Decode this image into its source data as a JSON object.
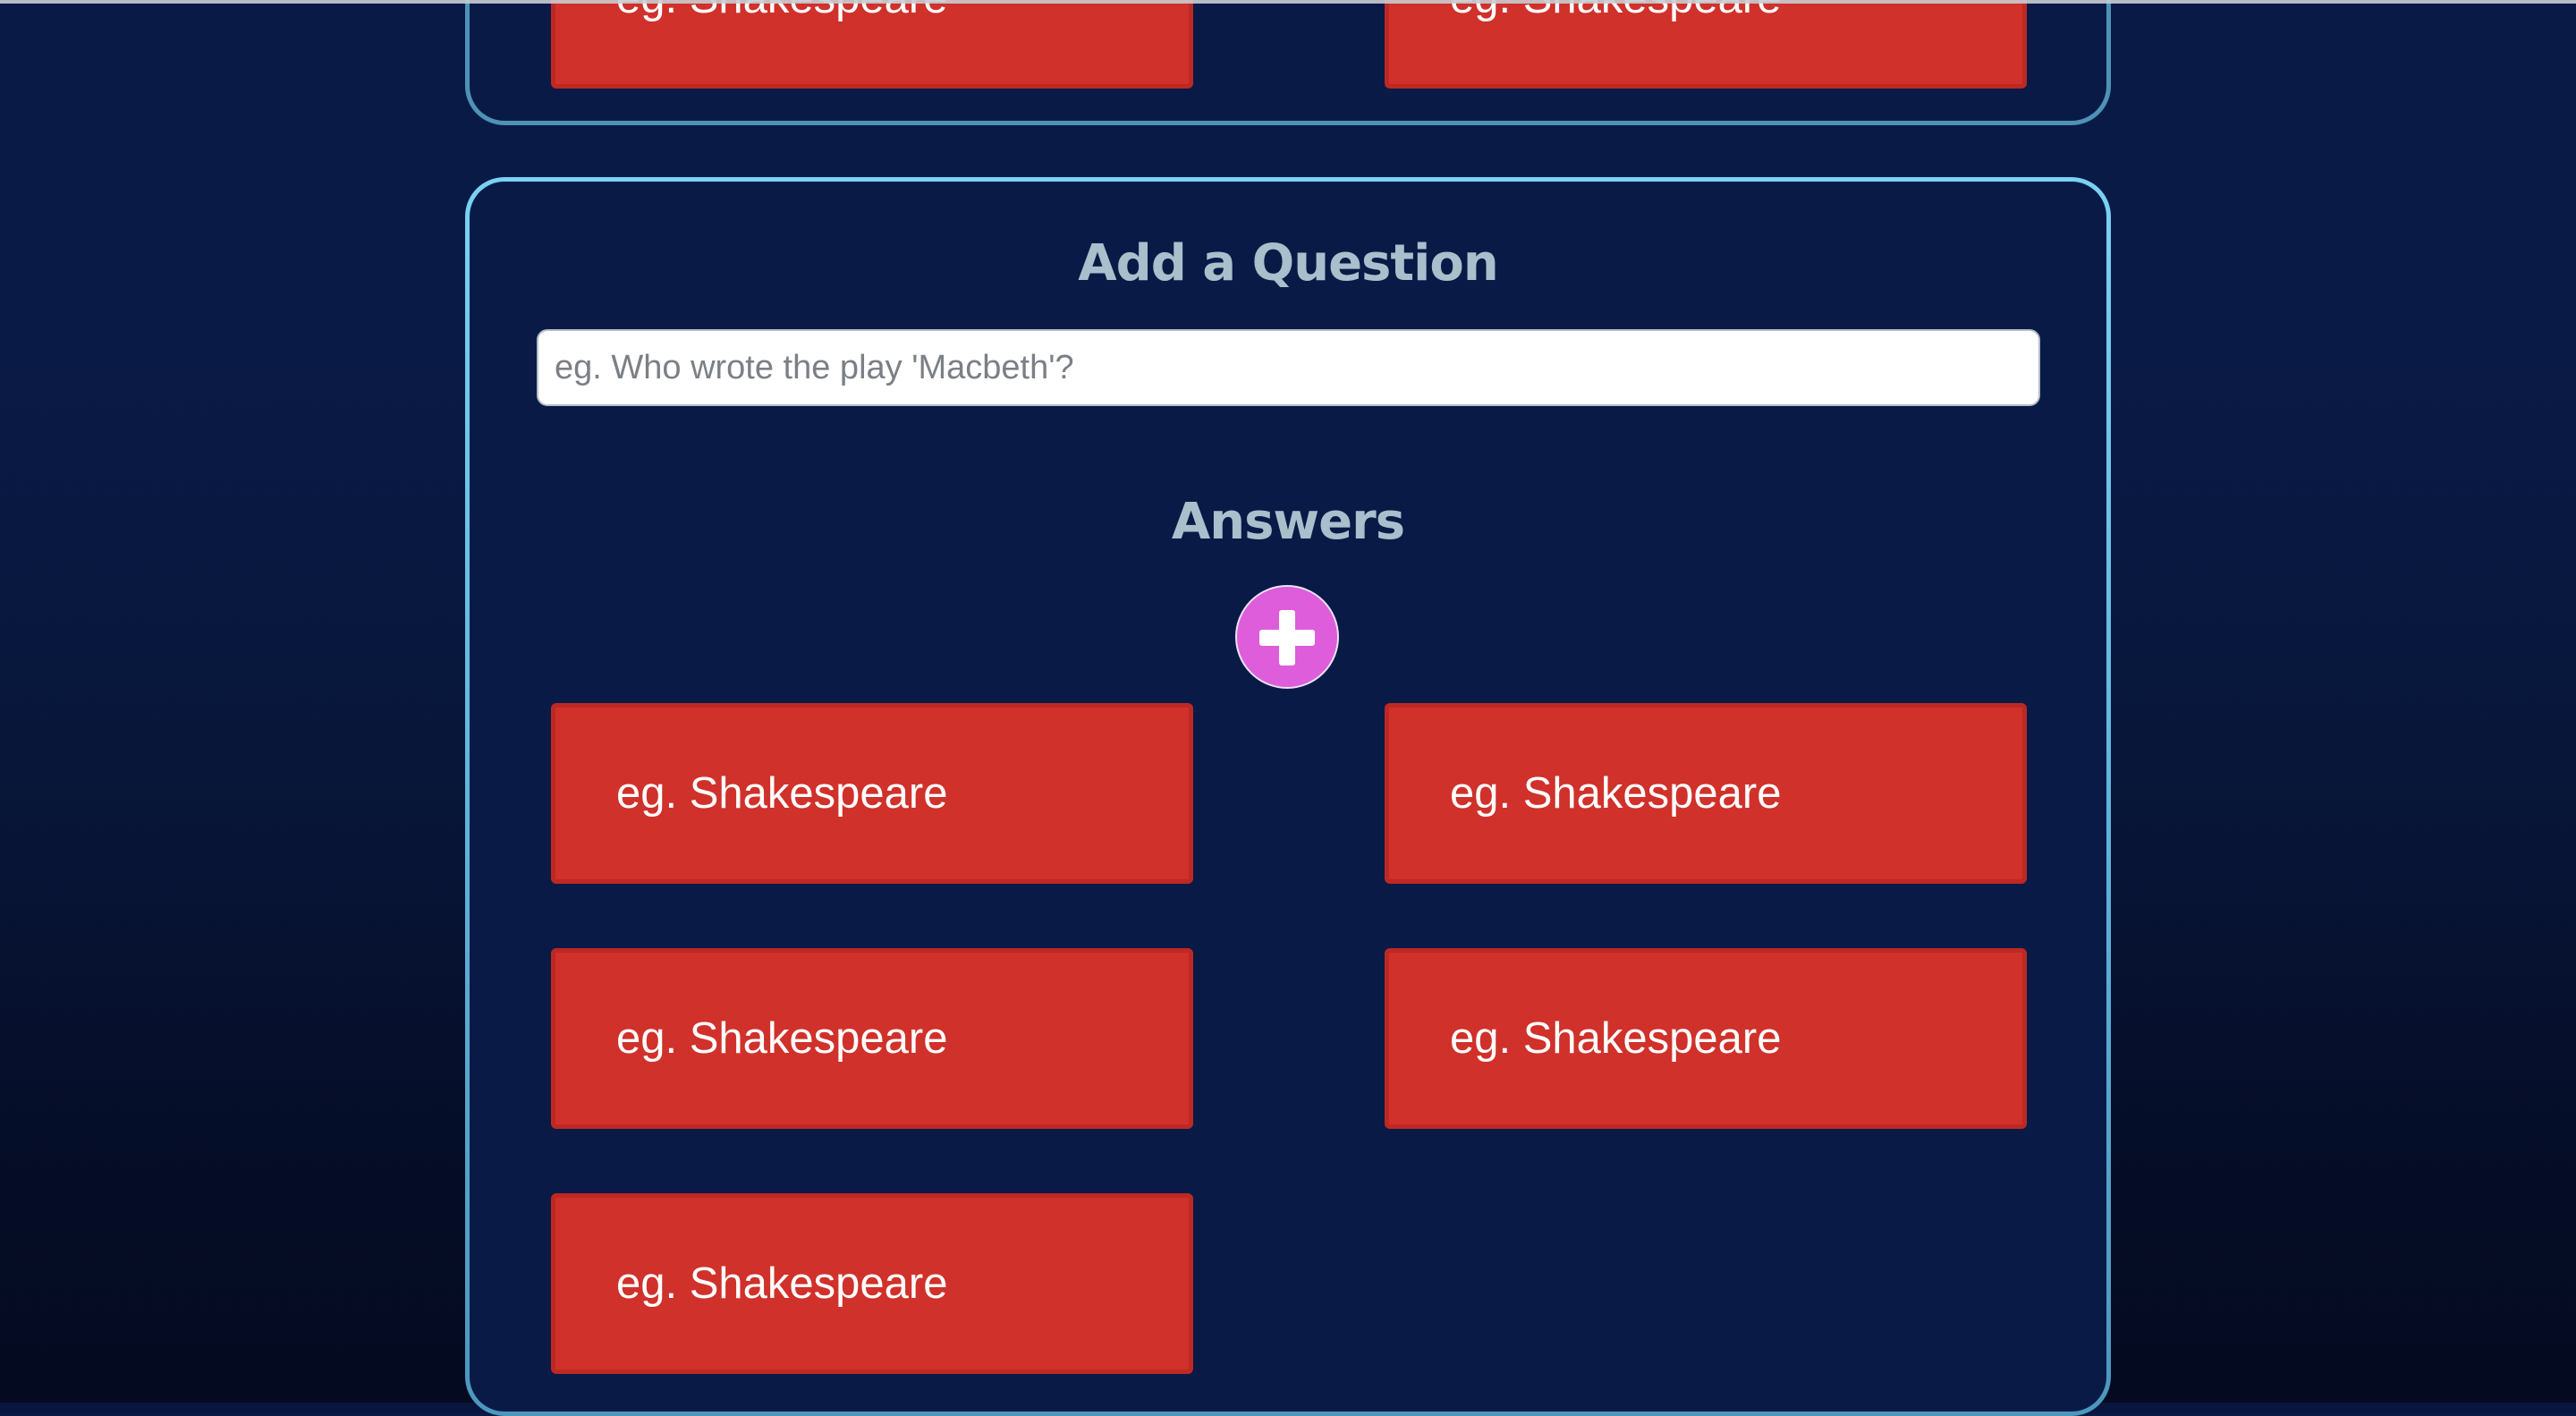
{
  "previous_question": {
    "answers": [
      {
        "placeholder": "eg. Shakespeare"
      },
      {
        "placeholder": "eg. Shakespeare"
      }
    ]
  },
  "question_form": {
    "title": "Add a Question",
    "question_placeholder": "eg. Who wrote the play 'Macbeth'?",
    "answers_heading": "Answers",
    "add_answer_icon": "plus-icon",
    "answers": [
      {
        "placeholder": "eg. Shakespeare"
      },
      {
        "placeholder": "eg. Shakespeare"
      },
      {
        "placeholder": "eg. Shakespeare"
      },
      {
        "placeholder": "eg. Shakespeare"
      },
      {
        "placeholder": "eg. Shakespeare"
      }
    ]
  },
  "colors": {
    "background": "#0a1a47",
    "panel_border": "#63b7de",
    "answer_fill": "#d0312a",
    "add_button": "#dd5ddb",
    "heading_text": "#a9bfcc"
  }
}
